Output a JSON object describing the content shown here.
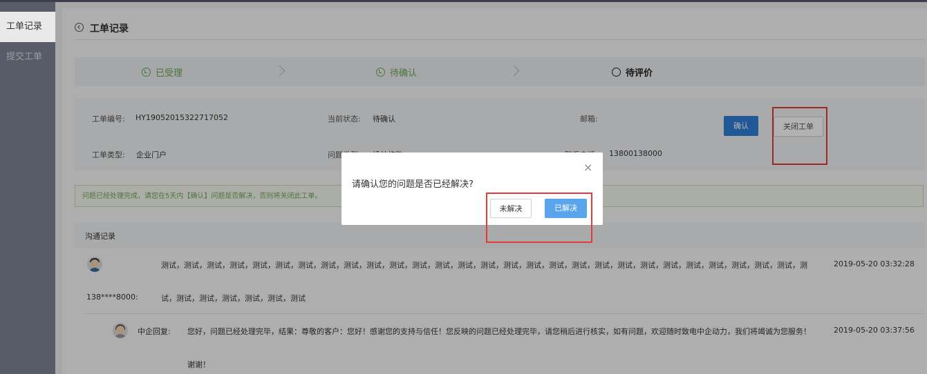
{
  "sidebar": {
    "items": [
      {
        "label": "工单记录"
      },
      {
        "label": "提交工单"
      }
    ]
  },
  "header": {
    "title": "工单记录"
  },
  "steps": [
    {
      "label": "已受理"
    },
    {
      "label": "待确认"
    },
    {
      "label": "待评价"
    }
  ],
  "ticket": {
    "number_label": "工单编号:",
    "number_value": "HY19052015322717052",
    "status_label": "当前状态:",
    "status_value": "待确认",
    "email_label": "邮箱:",
    "type_label": "工单类型:",
    "type_value": "企业门户",
    "issue_label": "问题类型:",
    "issue_value": "设计修改",
    "phone_label": "联系电话:",
    "phone_value": "13800138000"
  },
  "actions": {
    "confirm": "确认",
    "close_ticket": "关闭工单"
  },
  "notice": "问题已经处理完成，请您在5天内【确认】问题是否解决，否则将关闭此工单。",
  "communication": {
    "title": "沟通记录",
    "messages": [
      {
        "user": "138****8000:",
        "line1": "测试，测试，测试，测试，测试，测试，测试，测试，测试，测试，测试，测试，测试，测试，测试，测试，测试，测试，测试，测试，测试，测试，测试，测试，测试，测试，测试，测试，测",
        "line2": "试，测试，测试，测试，测试，测试，测试",
        "time": "2019-05-20 03:32:28"
      },
      {
        "user": "中企回复:",
        "line1": "您好，问题已经处理完毕，结果：尊敬的客户：您好！感谢您的支持与信任！您反映的问题已经处理完毕，请您稍后进行核实，如有问题，欢迎随时致电中企动力，我们将竭诚为您服务！",
        "line2": "谢谢！",
        "time": "2019-05-20 03:37:56"
      }
    ]
  },
  "modal": {
    "message": "请确认您的问题是否已经解决?",
    "close_icon": "×",
    "no_label": "未解决",
    "yes_label": "已解决"
  },
  "colors": {
    "accent": "#2f7fd8",
    "success": "#6aa84f",
    "highlight_box": "#e53935"
  }
}
